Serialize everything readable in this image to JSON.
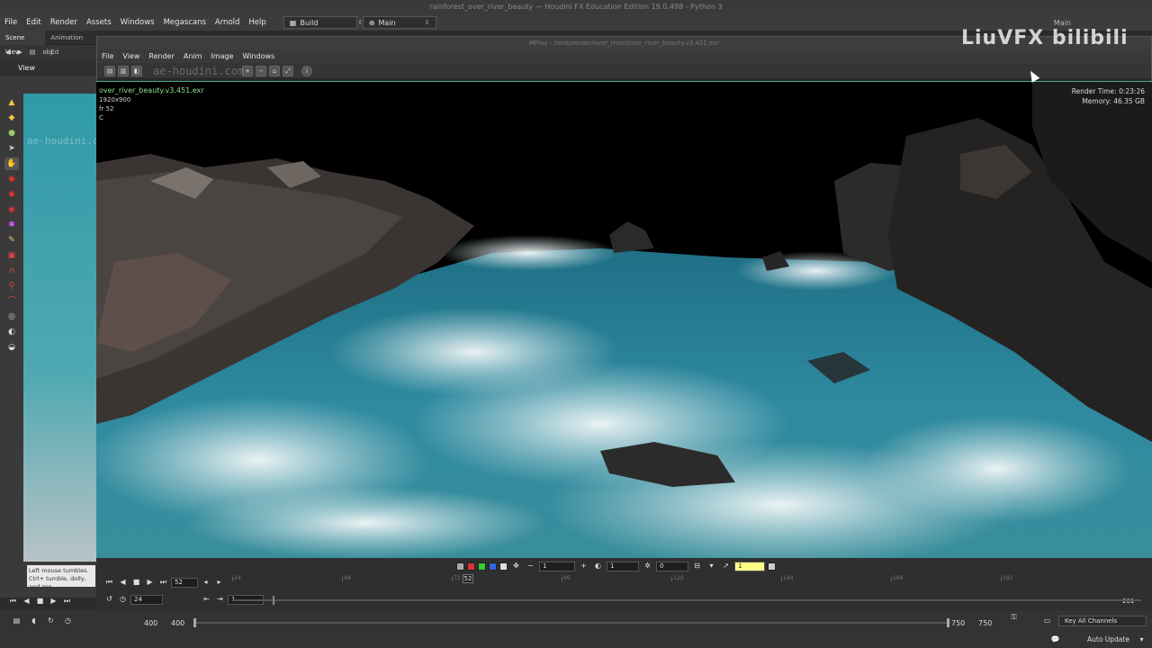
{
  "window_title": "rainforest_over_river_beauty — Houdini FX Education Edition 19.0.498 - Python 3",
  "main_menu": [
    "File",
    "Edit",
    "Render",
    "Assets",
    "Windows",
    "Megascans",
    "Arnold",
    "Help"
  ],
  "desktop": {
    "label": "Build",
    "context": "Main"
  },
  "right_top": {
    "label": "Main"
  },
  "left_panel": {
    "tabs": [
      "Scene View",
      "Animation Ed"
    ],
    "path": "obj",
    "view_label": "View",
    "watermark": "ae-houdini.com",
    "hint": "Left mouse tumbles. Ctrl+ tumble, dolly, and zoo"
  },
  "mplay": {
    "title": "MPlay - /mnt/render/over_river/over_river_beauty.v3.451.exr",
    "menu": [
      "File",
      "View",
      "Render",
      "Anim",
      "Image",
      "Windows"
    ],
    "watermark": "ae-houdini.com"
  },
  "image_info": {
    "filename": "over_river_beauty.v3.451.exr",
    "resolution": "1920x900",
    "frame": "fr 52",
    "channel": "C"
  },
  "render_info": {
    "render_time_label": "Render Time:",
    "render_time": "0:23:26",
    "memory_label": "Memory:",
    "memory": "46.35 GB"
  },
  "brand": "LiuVFX bilibili",
  "mplay_controls": {
    "current_frame": "52",
    "fps": "24",
    "start": "1",
    "end": "201",
    "field_a": "1",
    "field_b": "1",
    "field_c": "0",
    "field_yellow": "1",
    "marker": "52",
    "ticks": [
      "24",
      "48",
      "72",
      "96",
      "120",
      "144",
      "168",
      "192"
    ]
  },
  "houdini_bar": {
    "start": "400",
    "start2": "400",
    "end": "750",
    "end2": "750",
    "key_channels": "Key All Channels",
    "auto_update": "Auto Update"
  },
  "colors": {
    "accent_green": "#44aa88",
    "teal_view": "#2f9aa7",
    "water": "#2e7f92"
  }
}
